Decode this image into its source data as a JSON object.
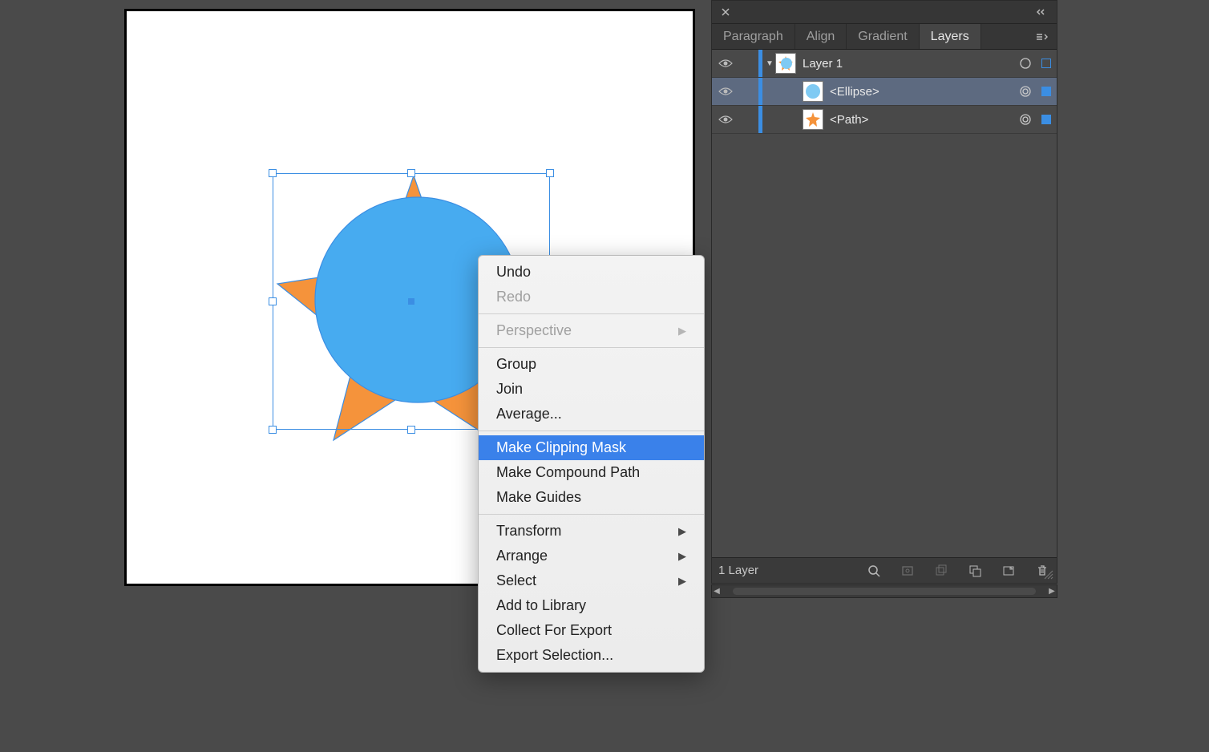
{
  "panel": {
    "tabs": [
      {
        "label": "Paragraph",
        "active": false
      },
      {
        "label": "Align",
        "active": false
      },
      {
        "label": "Gradient",
        "active": false
      },
      {
        "label": "Layers",
        "active": true
      }
    ],
    "layers": [
      {
        "name": "Layer 1",
        "type": "layer",
        "expanded": true,
        "selected": false,
        "sel_indicator": "hollow",
        "indent": 0,
        "sel_strip": "#3b8ee3",
        "thumb": "layer1"
      },
      {
        "name": "<Ellipse>",
        "type": "object",
        "selected": true,
        "sel_indicator": "filled",
        "indent": 1,
        "sel_strip": "#3b8ee3",
        "thumb": "ellipse"
      },
      {
        "name": "<Path>",
        "type": "object",
        "selected": false,
        "sel_indicator": "filled",
        "indent": 1,
        "sel_strip": "#3b8ee3",
        "thumb": "star"
      }
    ],
    "footer_label": "1 Layer"
  },
  "context_menu": {
    "groups": [
      [
        {
          "label": "Undo",
          "enabled": true
        },
        {
          "label": "Redo",
          "enabled": false
        }
      ],
      [
        {
          "label": "Perspective",
          "enabled": false,
          "submenu": true
        }
      ],
      [
        {
          "label": "Group",
          "enabled": true
        },
        {
          "label": "Join",
          "enabled": true
        },
        {
          "label": "Average...",
          "enabled": true
        }
      ],
      [
        {
          "label": "Make Clipping Mask",
          "enabled": true,
          "highlight": true
        },
        {
          "label": "Make Compound Path",
          "enabled": true
        },
        {
          "label": "Make Guides",
          "enabled": true
        }
      ],
      [
        {
          "label": "Transform",
          "enabled": true,
          "submenu": true
        },
        {
          "label": "Arrange",
          "enabled": true,
          "submenu": true
        },
        {
          "label": "Select",
          "enabled": true,
          "submenu": true
        },
        {
          "label": "Add to Library",
          "enabled": true
        },
        {
          "label": "Collect For Export",
          "enabled": true
        },
        {
          "label": "Export Selection...",
          "enabled": true
        }
      ]
    ]
  },
  "canvas": {
    "star_fill": "#f5933b",
    "circle_fill": "#47abf0",
    "selection_color": "#3b8ee3"
  }
}
